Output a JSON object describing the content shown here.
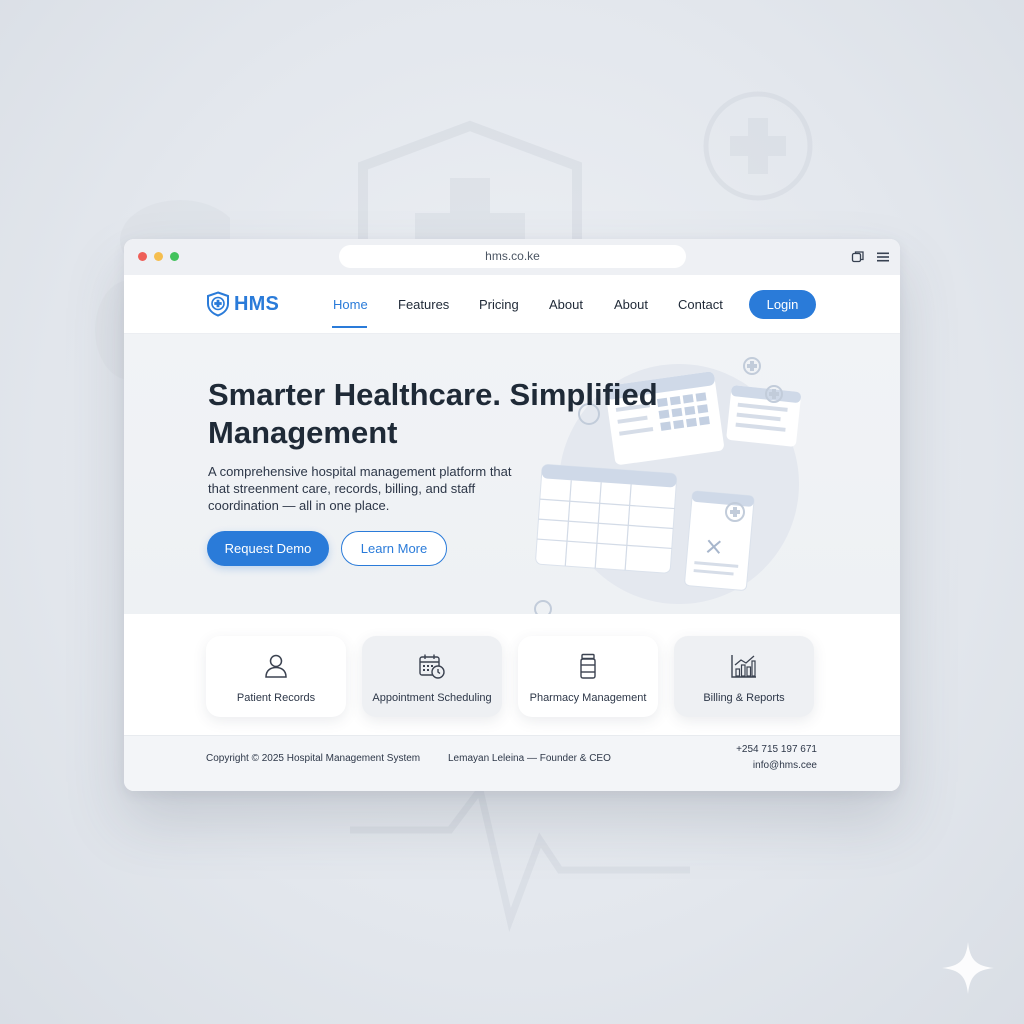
{
  "browser": {
    "url": "hms.co.ke"
  },
  "nav": {
    "logo_text": "HMS",
    "links": [
      {
        "label": "Home",
        "active": true
      },
      {
        "label": "Features"
      },
      {
        "label": "Pricing"
      },
      {
        "label": "About"
      },
      {
        "label": "About"
      },
      {
        "label": "Contact"
      }
    ],
    "login_label": "Login"
  },
  "hero": {
    "title": "Smarter Healthcare. Simplified Management",
    "description": "A comprehensive hospital management platform that that streenment care, records, billing, and staff coordination — all in one place.",
    "primary_button": "Request Demo",
    "secondary_button": "Learn More"
  },
  "features": [
    {
      "label": "Patient Records",
      "icon": "user-icon"
    },
    {
      "label": "Appointment Scheduling",
      "icon": "calendar-clock-icon"
    },
    {
      "label": "Pharmacy Management",
      "icon": "medicine-bottle-icon"
    },
    {
      "label": "Billing & Reports",
      "icon": "bar-chart-icon"
    }
  ],
  "footer": {
    "copyright": "Copyright © 2025 Hospital Management System",
    "founder": "Lemayan Leleina — Founder & CEO",
    "phone": "+254 715 197 671",
    "email": "info@hms.cee"
  },
  "colors": {
    "accent": "#2a7bd9",
    "background": "#e3e7ed",
    "text": "#1f2a37"
  }
}
